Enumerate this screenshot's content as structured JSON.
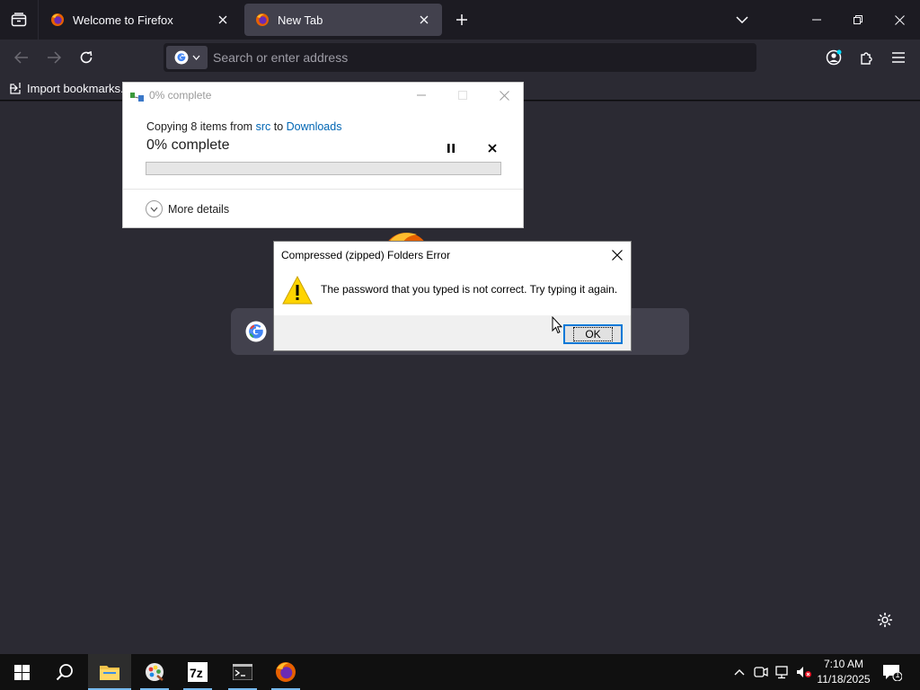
{
  "browser": {
    "tabs": [
      {
        "label": "Welcome to Firefox",
        "active": false
      },
      {
        "label": "New Tab",
        "active": true
      }
    ],
    "address_placeholder": "Search or enter address",
    "bookmarks": {
      "import_label": "Import bookmarks..."
    }
  },
  "copy_dialog": {
    "title": "0% complete",
    "line_prefix": "Copying 8 items from ",
    "source": "src",
    "line_mid": " to ",
    "destination": "Downloads",
    "percent_text": "0% complete",
    "progress": 0,
    "more_details": "More details"
  },
  "error_dialog": {
    "title": "Compressed (zipped) Folders Error",
    "message": "The password that you typed is not correct. Try typing it again.",
    "ok_label": "OK"
  },
  "taskbar": {
    "apps": [
      "start-icon",
      "search-icon",
      "file-explorer-icon",
      "paint-icon",
      "7zip-icon",
      "terminal-icon",
      "firefox-icon"
    ],
    "time": "7:10 AM",
    "date": "11/18/2025",
    "notification_count": "1"
  },
  "colors": {
    "firefox_bg": "#2b2a33",
    "tabstrip_bg": "#1c1b22",
    "link_blue": "#0066b4",
    "focus_blue": "#0078d7",
    "taskbar_bg": "#101010"
  }
}
